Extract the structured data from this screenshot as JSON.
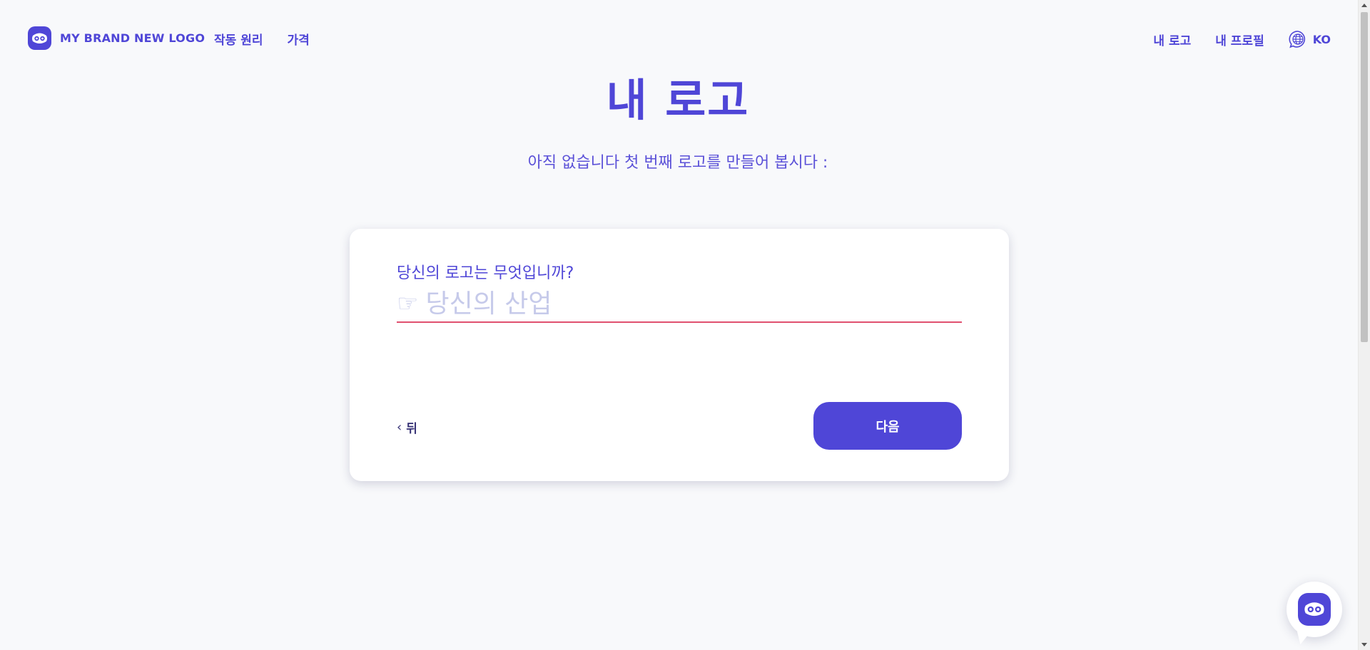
{
  "header": {
    "brand_name": "MY BRAND NEW LOGO",
    "nav_left": [
      {
        "label": "작동 원리"
      },
      {
        "label": "가격"
      }
    ],
    "nav_right": [
      {
        "label": "내 로고"
      },
      {
        "label": "내 프로필"
      }
    ],
    "language_code": "KO",
    "language_icon": "globe-chat-icon"
  },
  "main": {
    "title": "내 로고",
    "subtitle": "아직 없습니다 첫 번째 로고를 만들어 봅시다 :"
  },
  "form": {
    "question": "당신의 로고는 무엇입니까?",
    "input_icon": "☞",
    "input_placeholder": "당신의 산업",
    "input_value": "",
    "back_label": "뒤",
    "back_icon": "‹",
    "next_label": "다음"
  },
  "colors": {
    "brand": "#4f46d7",
    "input_underline": "#e0506f",
    "placeholder": "#c6caea",
    "background": "#f8f9fb"
  },
  "chat": {
    "icon": "brand-mascot-icon"
  }
}
